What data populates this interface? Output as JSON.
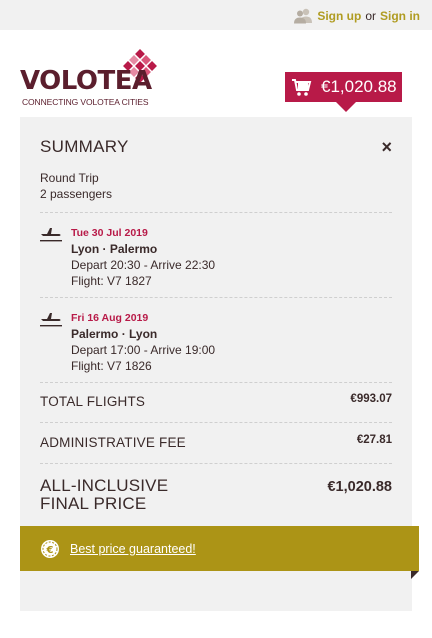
{
  "header": {
    "signup_label": "Sign up",
    "or_text": "or",
    "signin_label": "Sign in"
  },
  "logo": {
    "wordmark": "VOLOTEA",
    "tagline": "CONNECTING VOLOTEA CITIES"
  },
  "cart": {
    "total": "€1,020.88",
    "icon": "cart-icon"
  },
  "summary": {
    "title": "SUMMARY",
    "close_symbol": "×",
    "trip_type": "Round Trip",
    "passengers": "2 passengers",
    "segments": [
      {
        "date": "Tue 30 Jul 2019",
        "route": "Lyon · Palermo",
        "times": "Depart 20:30 - Arrive 22:30",
        "flight": "Flight: V7 1827"
      },
      {
        "date": "Fri 16 Aug 2019",
        "route": "Palermo · Lyon",
        "times": "Depart 17:00 - Arrive 19:00",
        "flight": "Flight: V7 1826"
      }
    ],
    "total_flights_label": "TOTAL FLIGHTS",
    "total_flights_value": "€993.07",
    "admin_fee_label": "ADMINISTRATIVE FEE",
    "admin_fee_value": "€27.81",
    "final_label_line1": "ALL-INCLUSIVE",
    "final_label_line2": "FINAL PRICE",
    "final_value": "€1,020.88"
  },
  "guarantee": {
    "text": "Best price guaranteed!",
    "icon": "euro-coin-icon"
  },
  "colors": {
    "brand_red": "#b81a48",
    "brand_maroon": "#5b1e2d",
    "gold": "#ac9416",
    "link_gold": "#b09c22"
  }
}
